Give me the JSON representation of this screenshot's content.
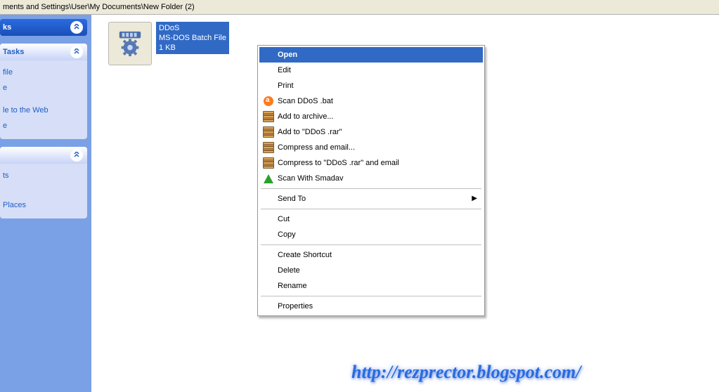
{
  "address_bar": "ments and Settings\\User\\My Documents\\New Folder (2)",
  "sidebar": {
    "panels": [
      {
        "title": "ks",
        "dark": true,
        "items": []
      },
      {
        "title": "Tasks",
        "dark": false,
        "items": [
          "file",
          "e",
          "le to the Web",
          "e"
        ]
      },
      {
        "title": "",
        "dark": false,
        "items": [
          "ts",
          "Places"
        ]
      }
    ]
  },
  "file": {
    "name": "DDoS",
    "type": "MS-DOS Batch File",
    "size": "1 KB"
  },
  "context_menu": [
    {
      "label": "Open",
      "icon": "",
      "selected": true
    },
    {
      "label": "Edit",
      "icon": ""
    },
    {
      "label": "Print",
      "icon": ""
    },
    {
      "label": "Scan DDoS .bat",
      "icon": "avast"
    },
    {
      "label": "Add to archive...",
      "icon": "rar"
    },
    {
      "label": "Add to \"DDoS .rar\"",
      "icon": "rar"
    },
    {
      "label": "Compress and email...",
      "icon": "rar"
    },
    {
      "label": "Compress to \"DDoS .rar\" and email",
      "icon": "rar"
    },
    {
      "label": "Scan With Smadav",
      "icon": "smadav"
    },
    {
      "sep": true
    },
    {
      "label": "Send To",
      "icon": "",
      "submenu": true
    },
    {
      "sep": true
    },
    {
      "label": "Cut",
      "icon": ""
    },
    {
      "label": "Copy",
      "icon": ""
    },
    {
      "sep": true
    },
    {
      "label": "Create Shortcut",
      "icon": ""
    },
    {
      "label": "Delete",
      "icon": ""
    },
    {
      "label": "Rename",
      "icon": ""
    },
    {
      "sep": true
    },
    {
      "label": "Properties",
      "icon": ""
    }
  ],
  "watermark": "http://rezprector.blogspot.com/"
}
